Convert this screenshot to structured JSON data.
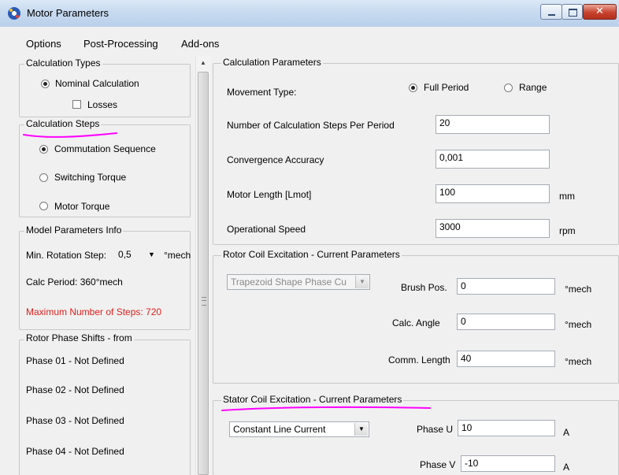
{
  "window": {
    "title": "Motor Parameters"
  },
  "menu": {
    "items": [
      "Options",
      "Post-Processing",
      "Add-ons"
    ]
  },
  "left": {
    "calc_types": {
      "title": "Calculation Types",
      "nominal": "Nominal Calculation",
      "losses": "Losses"
    },
    "calc_steps": {
      "title": "Calculation Steps",
      "options": [
        "Commutation Sequence",
        "Switching Torque",
        "Motor Torque"
      ],
      "selected": "Commutation Sequence"
    },
    "model_info": {
      "title": "Model Parameters Info",
      "min_rotation_label": "Min. Rotation Step:",
      "min_rotation_value": "0,5",
      "min_rotation_unit": "°mech",
      "calc_period": "Calc Period: 360°mech",
      "max_steps": "Maximum Number of Steps: 720"
    },
    "phase_shifts": {
      "title": "Rotor Phase Shifts - from",
      "items": [
        "Phase 01 - Not Defined",
        "Phase 02 - Not Defined",
        "Phase 03 - Not Defined",
        "Phase 04 - Not Defined"
      ]
    }
  },
  "calc_params": {
    "title": "Calculation Parameters",
    "movement_label": "Movement Type:",
    "movement_options": [
      "Full Period",
      "Range"
    ],
    "movement_selected": "Full Period",
    "steps_label": "Number of Calculation Steps Per Period",
    "steps_value": "20",
    "convergence_label": "Convergence Accuracy",
    "convergence_value": "0,001",
    "length_label": "Motor Length [Lmot]",
    "length_value": "100",
    "length_unit": "mm",
    "speed_label": "Operational Speed",
    "speed_value": "3000",
    "speed_unit": "rpm"
  },
  "rotor": {
    "title": "Rotor Coil Excitation - Current Parameters",
    "shape": "Trapezoid Shape Phase Cu",
    "brush_label": "Brush Pos.",
    "brush_value": "0",
    "brush_unit": "°mech",
    "angle_label": "Calc. Angle",
    "angle_value": "0",
    "angle_unit": "°mech",
    "comm_label": "Comm. Length",
    "comm_value": "40",
    "comm_unit": "°mech"
  },
  "stator": {
    "title": "Stator Coil Excitation - Current Parameters",
    "mode": "Constant Line Current",
    "phase_u_label": "Phase U",
    "phase_u_value": "10",
    "phase_u_unit": "A",
    "phase_v_label": "Phase V",
    "phase_v_value": "-10",
    "phase_v_unit": "A"
  },
  "colors": {
    "annotation": "#ff00ff",
    "warning_text": "#e02020"
  }
}
